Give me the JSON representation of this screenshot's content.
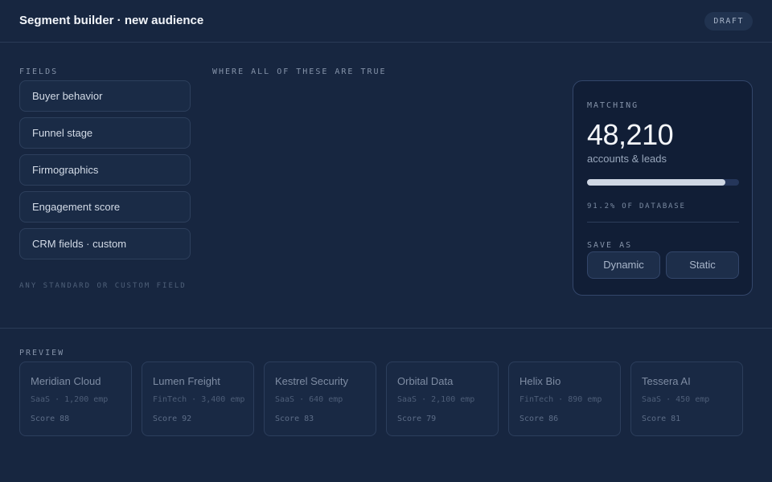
{
  "header": {
    "title": "Segment builder · new audience",
    "status": "DRAFT"
  },
  "fields": {
    "label": "FIELDS",
    "items": [
      {
        "label": "Buyer behavior"
      },
      {
        "label": "Funnel stage"
      },
      {
        "label": "Firmographics"
      },
      {
        "label": "Engagement score"
      },
      {
        "label": "CRM fields · custom"
      }
    ],
    "hint": "ANY STANDARD OR CUSTOM FIELD"
  },
  "conditions": {
    "label": "WHERE ALL OF THESE ARE TRUE"
  },
  "matching": {
    "label": "MATCHING",
    "count": "48,210",
    "sub": "accounts & leads",
    "percent": 91.2,
    "percent_label": "91.2% OF DATABASE",
    "save_label": "SAVE AS",
    "dynamic_label": "Dynamic",
    "static_label": "Static"
  },
  "preview": {
    "label": "PREVIEW",
    "cards": [
      {
        "name": "Meridian Cloud",
        "meta": "SaaS · 1,200 emp",
        "score": "Score 88"
      },
      {
        "name": "Lumen Freight",
        "meta": "FinTech · 3,400 emp",
        "score": "Score 92"
      },
      {
        "name": "Kestrel Security",
        "meta": "SaaS · 640 emp",
        "score": "Score 83"
      },
      {
        "name": "Orbital Data",
        "meta": "SaaS · 2,100 emp",
        "score": "Score 79"
      },
      {
        "name": "Helix Bio",
        "meta": "FinTech · 890 emp",
        "score": "Score 86"
      },
      {
        "name": "Tessera AI",
        "meta": "SaaS · 450 emp",
        "score": "Score 81"
      }
    ]
  }
}
